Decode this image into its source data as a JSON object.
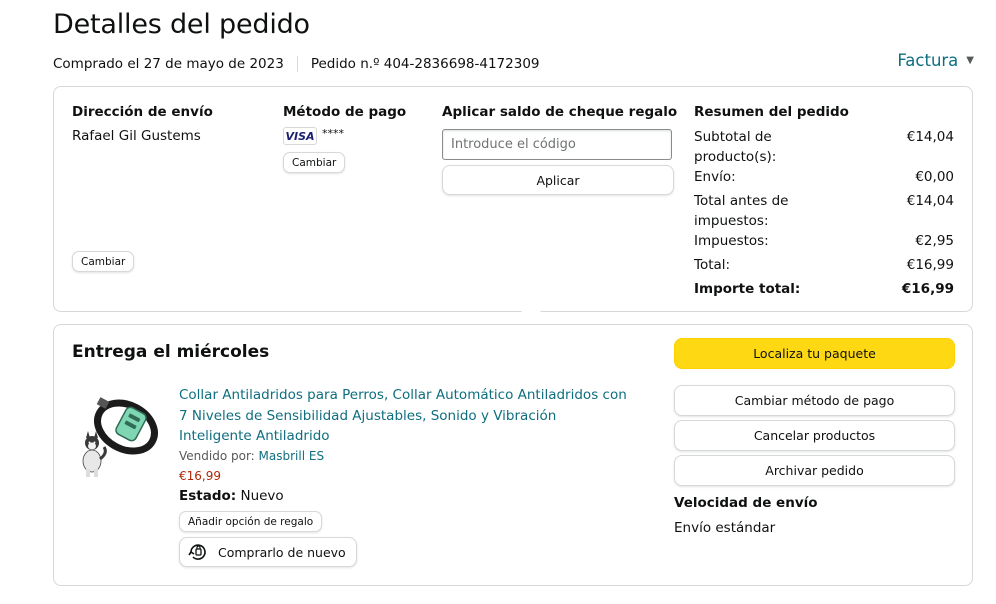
{
  "page": {
    "title": "Detalles del pedido",
    "purchased": "Comprado el 27 de mayo de 2023",
    "order_number": "Pedido n.º 404-2836698-4172309",
    "invoice_label": "Factura"
  },
  "shipping": {
    "heading": "Dirección de envío",
    "name": "Rafael Gil Gustems",
    "change_label": "Cambiar"
  },
  "payment": {
    "heading": "Método de pago",
    "card_brand": "VISA",
    "masked": "****",
    "change_label": "Cambiar"
  },
  "giftcard": {
    "heading": "Aplicar saldo de cheque regalo",
    "placeholder": "Introduce el código",
    "apply_label": "Aplicar"
  },
  "summary": {
    "heading": "Resumen del pedido",
    "rows": [
      {
        "label": "Subtotal de producto(s):",
        "value": "€14,04"
      },
      {
        "label": "Envío:",
        "value": "€0,00"
      },
      {
        "label": "Total antes de impuestos:",
        "value": "€14,04"
      },
      {
        "label": "Impuestos:",
        "value": "€2,95"
      },
      {
        "label": "Total:",
        "value": "€16,99"
      }
    ],
    "grand_label": "Importe total:",
    "grand_value": "€16,99"
  },
  "delivery": {
    "heading": "Entrega el miércoles",
    "product_title": "Collar Antiladridos para Perros, Collar Automático Antiladridos con 7 Niveles de Sensibilidad Ajustables, Sonido y Vibración Inteligente Antiladrido",
    "sold_by_label": "Vendido por:",
    "seller": "Masbrill ES",
    "price": "€16,99",
    "status_label": "Estado:",
    "status_value": "Nuevo",
    "gift_option_label": "Añadir opción de regalo",
    "rebuy_label": "Comprarlo de nuevo"
  },
  "actions": {
    "track_label": "Localiza tu paquete",
    "change_payment_label": "Cambiar método de pago",
    "cancel_label": "Cancelar productos",
    "archive_label": "Archivar pedido",
    "speed_heading": "Velocidad de envío",
    "speed_value": "Envío estándar"
  },
  "colors": {
    "link": "#0f6e7f",
    "price": "#b12704",
    "primary_button": "#ffd814",
    "border": "#d5d9d9"
  },
  "icons": {
    "invoice_chevron": "chevron-down-icon",
    "rebuy": "rebuy-icon"
  }
}
